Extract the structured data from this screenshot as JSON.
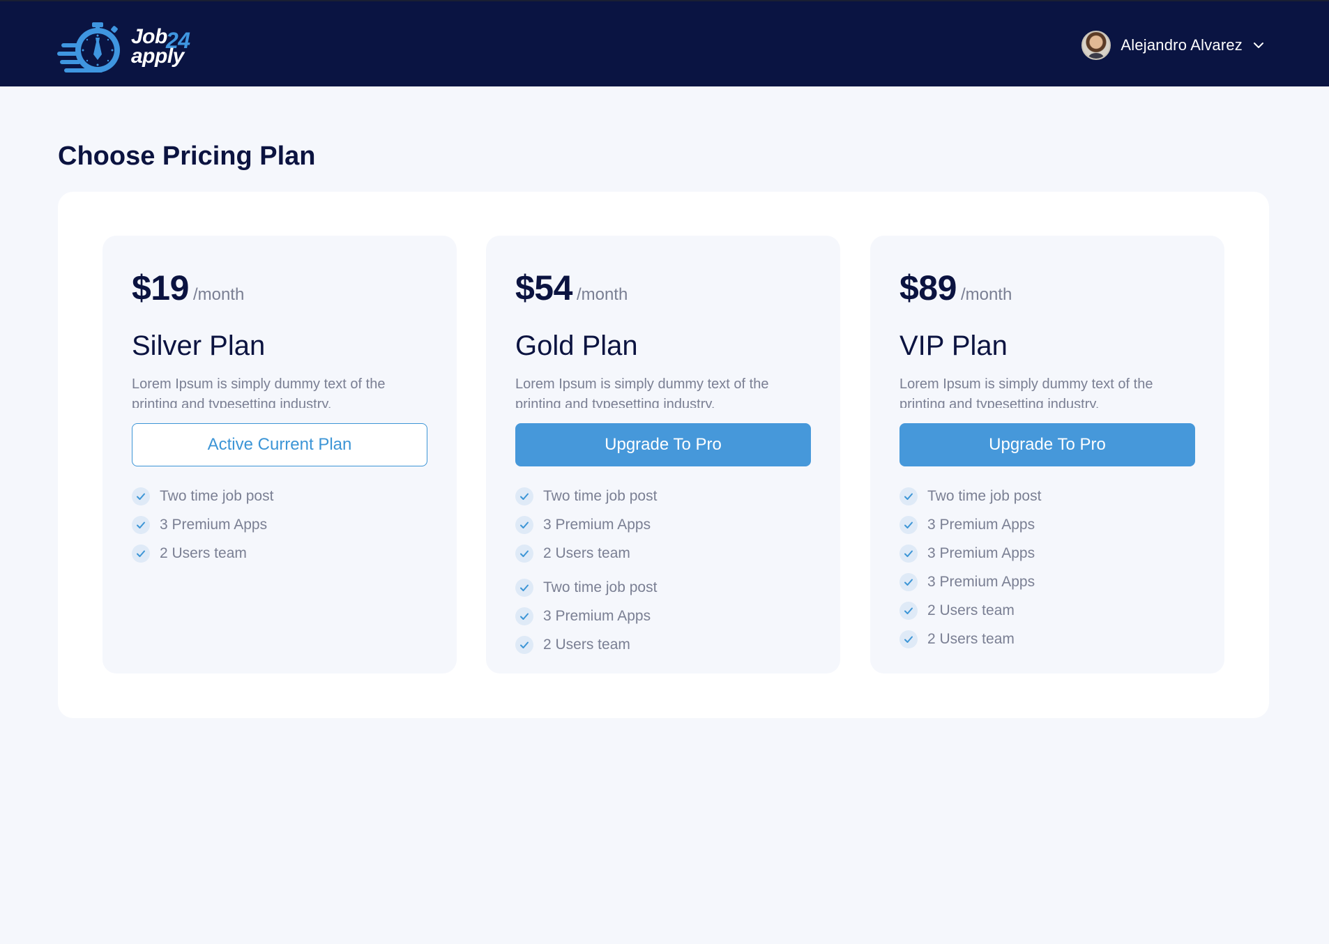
{
  "header": {
    "logo": {
      "word1": "Job",
      "number": "24",
      "word2": "apply"
    },
    "user": {
      "name": "Alejandro Alvarez"
    }
  },
  "page": {
    "title": "Choose Pricing Plan"
  },
  "colors": {
    "header_bg": "#0a1442",
    "accent": "#4698da",
    "text_dark": "#0b1340",
    "text_muted": "#7a7f93"
  },
  "icons": [
    "stopwatch-logo-icon",
    "chevron-down-icon",
    "check-icon"
  ],
  "plans": [
    {
      "price": "$19",
      "period": "/month",
      "name": "Silver Plan",
      "description": "Lorem Ipsum is simply dummy text of the printing and typesetting industry.",
      "button": "Active Current Plan",
      "features": [
        "Two time job post",
        "3 Premium Apps",
        "2 Users team"
      ]
    },
    {
      "price": "$54",
      "period": "/month",
      "name": "Gold Plan",
      "description": "Lorem Ipsum is simply dummy text of the printing and typesetting industry.",
      "button": "Upgrade To Pro",
      "features": [
        "Two time job post",
        "3 Premium Apps",
        "2 Users team",
        "Two time job post",
        "3 Premium Apps",
        "2 Users team"
      ]
    },
    {
      "price": "$89",
      "period": "/month",
      "name": "VIP Plan",
      "description": "Lorem Ipsum is simply dummy text of the printing and typesetting industry.",
      "button": "Upgrade To Pro",
      "features": [
        "Two time job post",
        "3 Premium Apps",
        "3 Premium Apps",
        "3 Premium Apps",
        "2 Users team",
        "2 Users team"
      ]
    }
  ]
}
